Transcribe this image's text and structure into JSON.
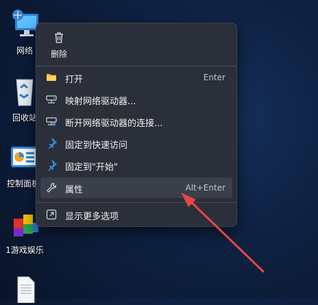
{
  "desktop": {
    "icons": [
      {
        "label": "网络"
      },
      {
        "label": "回收站"
      },
      {
        "label": "控制面板"
      },
      {
        "label": "1游戏娱乐"
      },
      {
        "label": ""
      }
    ]
  },
  "context_menu": {
    "delete_label": "删除",
    "items": [
      {
        "label": "打开",
        "shortcut": "Enter",
        "icon": "folder-icon"
      },
      {
        "label": "映射网络驱动器...",
        "icon": "map-drive-icon"
      },
      {
        "label": "断开网络驱动器的连接...",
        "icon": "disconnect-drive-icon"
      },
      {
        "label": "固定到快速访问",
        "icon": "pin-icon"
      },
      {
        "label": "固定到\"开始\"",
        "icon": "pin-icon"
      },
      {
        "label": "属性",
        "shortcut": "Alt+Enter",
        "icon": "wrench-icon"
      },
      {
        "label": "显示更多选项",
        "icon": "more-options-icon"
      }
    ]
  },
  "colors": {
    "annotation_arrow": "#e8473c",
    "accent": "#3aa0ff"
  }
}
